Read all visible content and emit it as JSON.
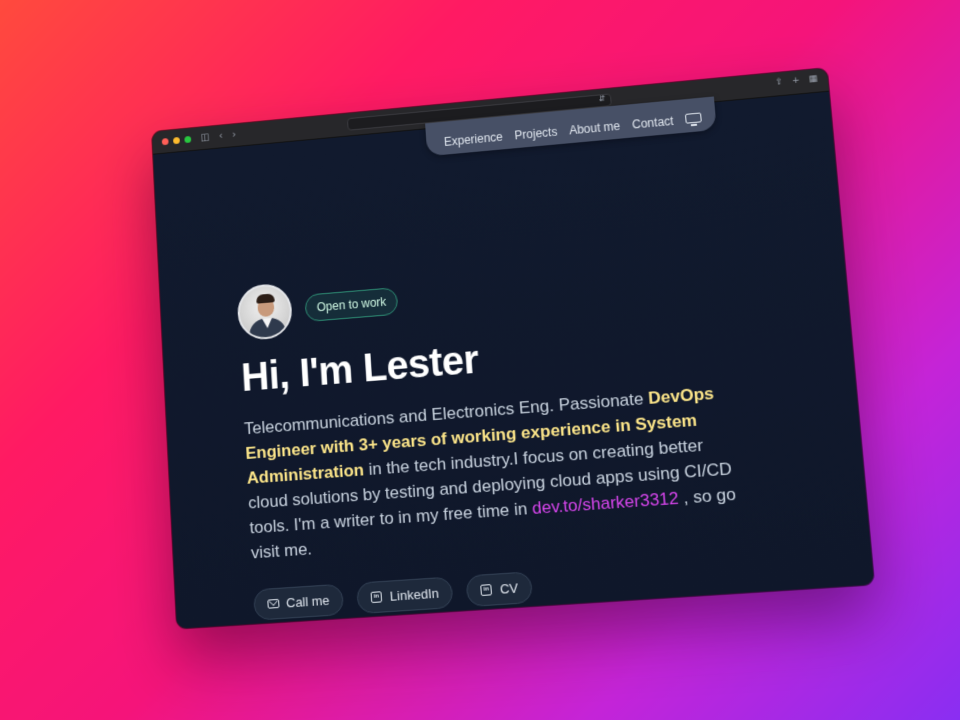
{
  "browser": {
    "window_buttons": [
      "close",
      "minimize",
      "zoom"
    ],
    "toolbar_icons": [
      "sidebar-icon",
      "back-icon",
      "forward-icon"
    ],
    "right_icons": [
      "share-icon",
      "new-tab-icon",
      "tabs-overview-icon"
    ],
    "url": ""
  },
  "nav": {
    "items": [
      "Experience",
      "Projects",
      "About me",
      "Contact"
    ],
    "theme_icon": "monitor-icon"
  },
  "hero": {
    "status_badge": "Open to work",
    "title": "Hi, I'm Lester",
    "desc_1": "Telecommunications and Electronics Eng. Passionate ",
    "desc_highlight": "DevOps Engineer with 3+ years of working experience in System Administration",
    "desc_2": " in the tech industry.I focus on creating better cloud solutions by testing and deploying cloud apps using CI/CD tools. I'm a writer to in my free time in ",
    "desc_link": "dev.to/sharker3312",
    "desc_3": " , so go visit me."
  },
  "buttons": [
    {
      "label": "Call me",
      "icon": "mail-icon"
    },
    {
      "label": "LinkedIn",
      "icon": "linkedin-icon"
    },
    {
      "label": "CV",
      "icon": "linkedin-icon"
    }
  ],
  "colors": {
    "background_gradient": [
      "#ff4a3d",
      "#ff1a63",
      "#c424d8",
      "#8a2ef2"
    ],
    "page_bg": "#0f172a",
    "highlight": "#fde68a",
    "link": "#d946ef",
    "badge_border": "#2e8f75"
  }
}
